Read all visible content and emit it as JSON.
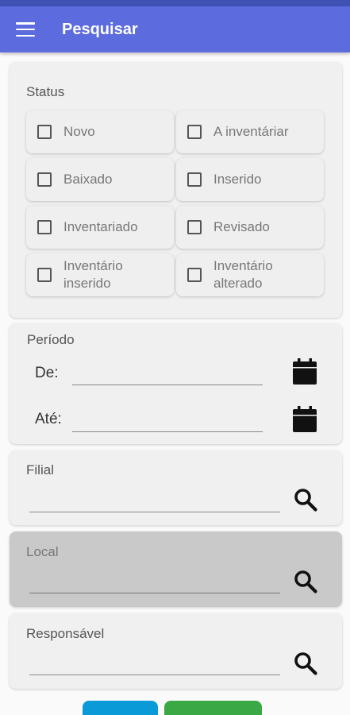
{
  "appbar": {
    "title": "Pesquisar"
  },
  "status": {
    "label": "Status",
    "options": [
      "Novo",
      "A inventáriar",
      "Baixado",
      "Inserido",
      "Inventariado",
      "Revisado",
      "Inventário inserido",
      "Inventário alterado"
    ]
  },
  "periodo": {
    "label": "Período",
    "de_label": "De:",
    "ate_label": "Até:"
  },
  "filial": {
    "label": "Filial"
  },
  "local": {
    "label": "Local"
  },
  "responsavel": {
    "label": "Responsável"
  },
  "colors": {
    "appbar": "#5c6bde",
    "button_blue": "#0b9ad8",
    "button_green": "#3aa845"
  }
}
